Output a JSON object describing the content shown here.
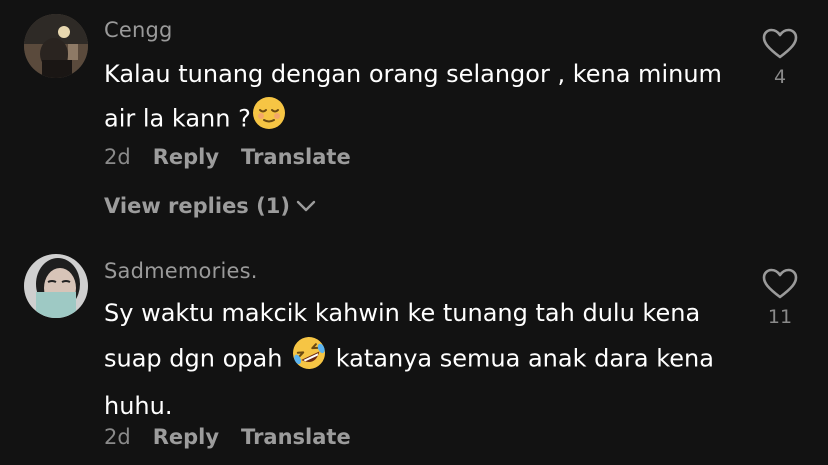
{
  "comments": [
    {
      "username": "Cengg",
      "text_before": "Kalau tunang dengan orang selangor , kena minum air la kann ?",
      "text_after": "",
      "emoji": "relieved-face-icon",
      "time": "2d",
      "reply_label": "Reply",
      "translate_label": "Translate",
      "likes": "4",
      "view_replies": "View replies (1)"
    },
    {
      "username": "Sadmemories.",
      "text_before": "Sy waktu makcik kahwin ke tunang tah dulu kena suap dgn opah ",
      "text_after": " katanya semua anak dara kena huhu.",
      "emoji": "rolling-laughing-face-icon",
      "time": "2d",
      "reply_label": "Reply",
      "translate_label": "Translate",
      "likes": "11"
    }
  ],
  "colors": {
    "background": "#121212",
    "username": "#9a9a9a",
    "secondary": "#8a8a8a",
    "emoji_yellow": "#f6c544"
  }
}
